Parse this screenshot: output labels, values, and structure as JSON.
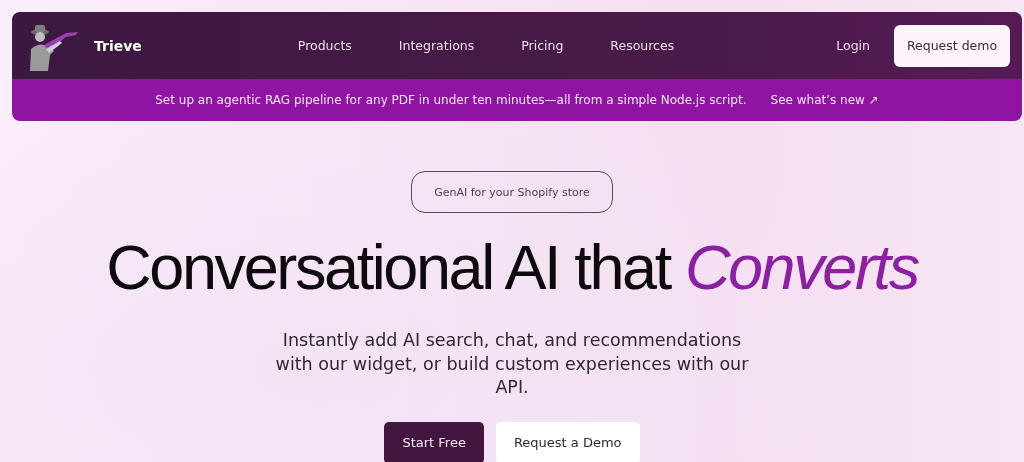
{
  "header": {
    "brand": "Trieve",
    "nav": [
      {
        "label": "Products"
      },
      {
        "label": "Integrations"
      },
      {
        "label": "Pricing"
      },
      {
        "label": "Resources"
      }
    ],
    "login": "Login",
    "cta": "Request demo"
  },
  "banner": {
    "text": "Set up an agentic RAG pipeline for any PDF in under ten minutes—all from a simple Node.js script.",
    "link": "See what’s new ↗"
  },
  "hero": {
    "pill": "GenAI for your Shopify store",
    "headline": "Conversational AI that *Converts*",
    "subtitle": "Instantly add AI search, chat, and recommendations with our widget, or build custom experiences with our API.",
    "buttons": [
      {
        "label": "Start Free",
        "kind": "primary"
      },
      {
        "label": "Request a Demo",
        "kind": "secondary"
      }
    ]
  }
}
